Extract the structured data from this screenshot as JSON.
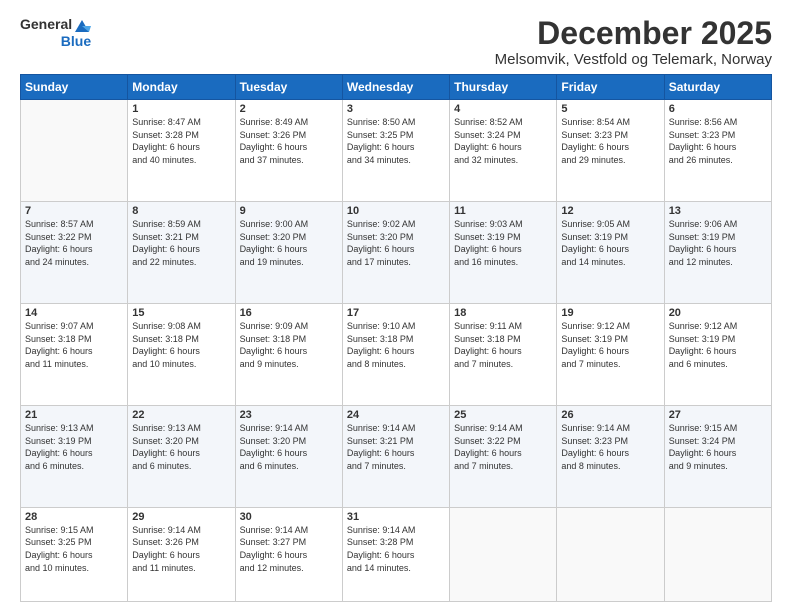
{
  "header": {
    "logo_general": "General",
    "logo_blue": "Blue",
    "month": "December 2025",
    "location": "Melsomvik, Vestfold og Telemark, Norway"
  },
  "days_of_week": [
    "Sunday",
    "Monday",
    "Tuesday",
    "Wednesday",
    "Thursday",
    "Friday",
    "Saturday"
  ],
  "weeks": [
    [
      {
        "day": "",
        "info": ""
      },
      {
        "day": "1",
        "info": "Sunrise: 8:47 AM\nSunset: 3:28 PM\nDaylight: 6 hours\nand 40 minutes."
      },
      {
        "day": "2",
        "info": "Sunrise: 8:49 AM\nSunset: 3:26 PM\nDaylight: 6 hours\nand 37 minutes."
      },
      {
        "day": "3",
        "info": "Sunrise: 8:50 AM\nSunset: 3:25 PM\nDaylight: 6 hours\nand 34 minutes."
      },
      {
        "day": "4",
        "info": "Sunrise: 8:52 AM\nSunset: 3:24 PM\nDaylight: 6 hours\nand 32 minutes."
      },
      {
        "day": "5",
        "info": "Sunrise: 8:54 AM\nSunset: 3:23 PM\nDaylight: 6 hours\nand 29 minutes."
      },
      {
        "day": "6",
        "info": "Sunrise: 8:56 AM\nSunset: 3:23 PM\nDaylight: 6 hours\nand 26 minutes."
      }
    ],
    [
      {
        "day": "7",
        "info": "Sunrise: 8:57 AM\nSunset: 3:22 PM\nDaylight: 6 hours\nand 24 minutes."
      },
      {
        "day": "8",
        "info": "Sunrise: 8:59 AM\nSunset: 3:21 PM\nDaylight: 6 hours\nand 22 minutes."
      },
      {
        "day": "9",
        "info": "Sunrise: 9:00 AM\nSunset: 3:20 PM\nDaylight: 6 hours\nand 19 minutes."
      },
      {
        "day": "10",
        "info": "Sunrise: 9:02 AM\nSunset: 3:20 PM\nDaylight: 6 hours\nand 17 minutes."
      },
      {
        "day": "11",
        "info": "Sunrise: 9:03 AM\nSunset: 3:19 PM\nDaylight: 6 hours\nand 16 minutes."
      },
      {
        "day": "12",
        "info": "Sunrise: 9:05 AM\nSunset: 3:19 PM\nDaylight: 6 hours\nand 14 minutes."
      },
      {
        "day": "13",
        "info": "Sunrise: 9:06 AM\nSunset: 3:19 PM\nDaylight: 6 hours\nand 12 minutes."
      }
    ],
    [
      {
        "day": "14",
        "info": "Sunrise: 9:07 AM\nSunset: 3:18 PM\nDaylight: 6 hours\nand 11 minutes."
      },
      {
        "day": "15",
        "info": "Sunrise: 9:08 AM\nSunset: 3:18 PM\nDaylight: 6 hours\nand 10 minutes."
      },
      {
        "day": "16",
        "info": "Sunrise: 9:09 AM\nSunset: 3:18 PM\nDaylight: 6 hours\nand 9 minutes."
      },
      {
        "day": "17",
        "info": "Sunrise: 9:10 AM\nSunset: 3:18 PM\nDaylight: 6 hours\nand 8 minutes."
      },
      {
        "day": "18",
        "info": "Sunrise: 9:11 AM\nSunset: 3:18 PM\nDaylight: 6 hours\nand 7 minutes."
      },
      {
        "day": "19",
        "info": "Sunrise: 9:12 AM\nSunset: 3:19 PM\nDaylight: 6 hours\nand 7 minutes."
      },
      {
        "day": "20",
        "info": "Sunrise: 9:12 AM\nSunset: 3:19 PM\nDaylight: 6 hours\nand 6 minutes."
      }
    ],
    [
      {
        "day": "21",
        "info": "Sunrise: 9:13 AM\nSunset: 3:19 PM\nDaylight: 6 hours\nand 6 minutes."
      },
      {
        "day": "22",
        "info": "Sunrise: 9:13 AM\nSunset: 3:20 PM\nDaylight: 6 hours\nand 6 minutes."
      },
      {
        "day": "23",
        "info": "Sunrise: 9:14 AM\nSunset: 3:20 PM\nDaylight: 6 hours\nand 6 minutes."
      },
      {
        "day": "24",
        "info": "Sunrise: 9:14 AM\nSunset: 3:21 PM\nDaylight: 6 hours\nand 7 minutes."
      },
      {
        "day": "25",
        "info": "Sunrise: 9:14 AM\nSunset: 3:22 PM\nDaylight: 6 hours\nand 7 minutes."
      },
      {
        "day": "26",
        "info": "Sunrise: 9:14 AM\nSunset: 3:23 PM\nDaylight: 6 hours\nand 8 minutes."
      },
      {
        "day": "27",
        "info": "Sunrise: 9:15 AM\nSunset: 3:24 PM\nDaylight: 6 hours\nand 9 minutes."
      }
    ],
    [
      {
        "day": "28",
        "info": "Sunrise: 9:15 AM\nSunset: 3:25 PM\nDaylight: 6 hours\nand 10 minutes."
      },
      {
        "day": "29",
        "info": "Sunrise: 9:14 AM\nSunset: 3:26 PM\nDaylight: 6 hours\nand 11 minutes."
      },
      {
        "day": "30",
        "info": "Sunrise: 9:14 AM\nSunset: 3:27 PM\nDaylight: 6 hours\nand 12 minutes."
      },
      {
        "day": "31",
        "info": "Sunrise: 9:14 AM\nSunset: 3:28 PM\nDaylight: 6 hours\nand 14 minutes."
      },
      {
        "day": "",
        "info": ""
      },
      {
        "day": "",
        "info": ""
      },
      {
        "day": "",
        "info": ""
      }
    ]
  ]
}
